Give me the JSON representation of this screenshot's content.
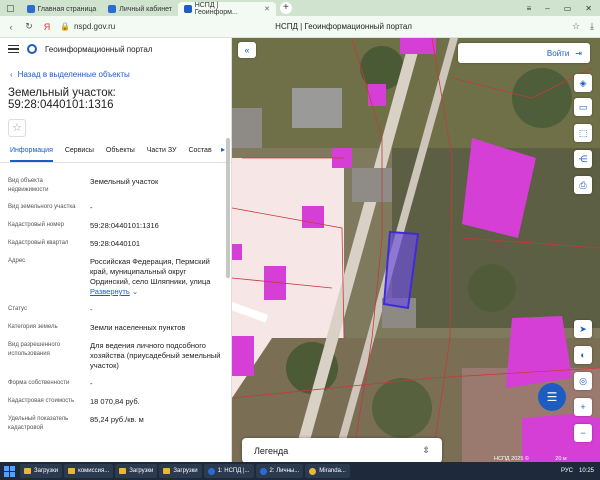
{
  "browser": {
    "tabs": [
      {
        "label": "Главная страница"
      },
      {
        "label": "Личный кабинет"
      },
      {
        "label": "НСПД | Геоинформ..."
      }
    ],
    "url": "nspd.gov.ru",
    "page_title": "НСПД | Геоинформационный портал"
  },
  "portal": {
    "name": "Геоинформационный портал",
    "back_link": "Назад в выделенные объекты",
    "object_title": "Земельный участок: 59:28:0440101:1316",
    "tabs": [
      "Информация",
      "Сервисы",
      "Объекты",
      "Части ЗУ",
      "Состав"
    ],
    "rows": [
      {
        "label": "Вид объекта недвижимости",
        "value": "Земельный участок"
      },
      {
        "label": "Вид земельного участка",
        "value": "-"
      },
      {
        "label": "Кадастровый номер",
        "value": "59:28:0440101:1316"
      },
      {
        "label": "Кадастровый квартал",
        "value": "59:28:0440101"
      },
      {
        "label": "Адрес",
        "value": "Российская Федерация, Пермский край, муниципальный округ Ординский, село Шляпники, улица",
        "link": "Развернуть"
      },
      {
        "label": "Статус",
        "value": "-"
      },
      {
        "label": "Категория земель",
        "value": "Земли населенных пунктов"
      },
      {
        "label": "Вид разрешенного использования",
        "value": "Для ведения личного подсобного хозяйства (приусадебный земельный участок)"
      },
      {
        "label": "Форма собственности",
        "value": "-"
      },
      {
        "label": "Кадастровая стоимость",
        "value": "18 070,84 руб."
      },
      {
        "label": "Удельный показатель кадастровой",
        "value": "85,24 руб./кв. м"
      }
    ]
  },
  "map": {
    "login_label": "Войти",
    "legend_label": "Легенда",
    "copyright": "НСПД 2025 ©",
    "scale": "20 м",
    "colors": {
      "parcel": "#d63fd6",
      "selected": "#6a4fe0",
      "road": "#f6e6e6"
    }
  },
  "taskbar": {
    "items": [
      "Загрузки",
      "комиссия...",
      "Загрузки",
      "Загрузки",
      "1: НСПД |...",
      "2: Личны...",
      "Miranda..."
    ],
    "lang": "РУС",
    "time": "10:25"
  }
}
